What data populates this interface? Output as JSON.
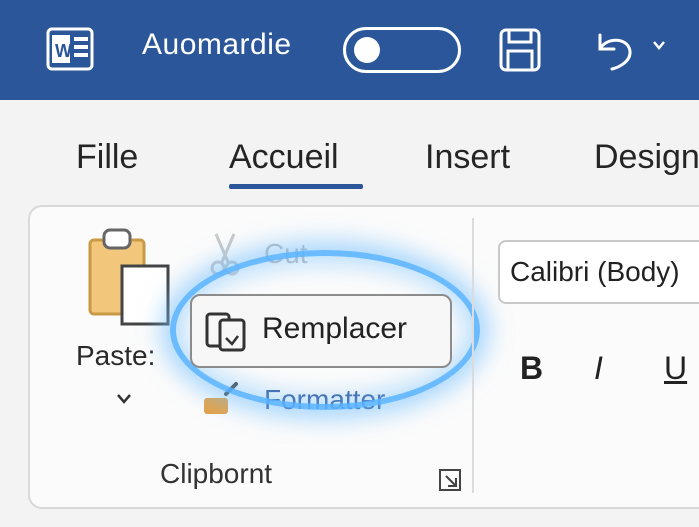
{
  "titlebar": {
    "title": "Auomardie",
    "autosave_state": "off",
    "icons": [
      "app-word-icon",
      "save-icon",
      "undo-icon",
      "chevron-down-icon"
    ]
  },
  "tabs": [
    {
      "label": "Fille",
      "active": false
    },
    {
      "label": "Accueil",
      "active": true
    },
    {
      "label": "Insert",
      "active": false
    },
    {
      "label": "Design",
      "active": false
    }
  ],
  "clipboard": {
    "paste_label": "Paste:",
    "cut_label": "Cut",
    "replace_label": "Remplacer",
    "format_label": "Formatter",
    "group_label": "Clipbornt"
  },
  "font": {
    "name": "Calibri (Body)",
    "bold": "B",
    "italic": "I",
    "underline": "U"
  },
  "colors": {
    "titlebar": "#2b579a",
    "highlight": "#5ab4ff"
  }
}
